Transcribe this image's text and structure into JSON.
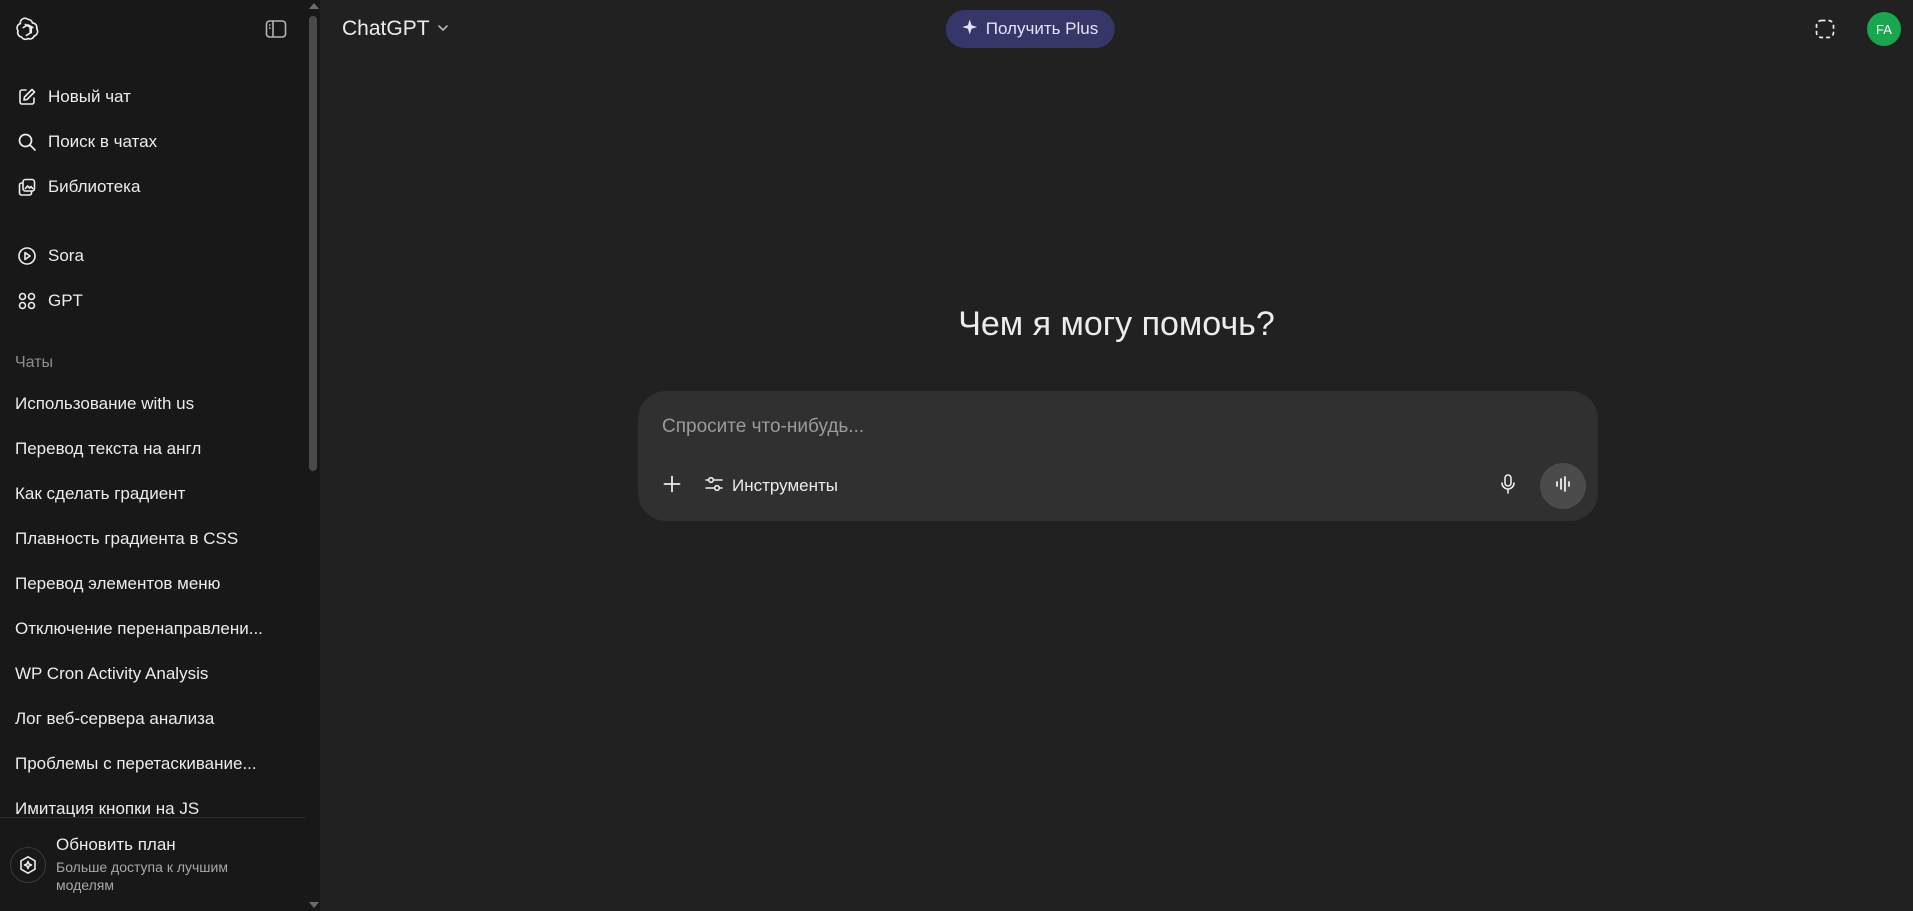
{
  "sidebar": {
    "nav": [
      {
        "label": "Новый чат",
        "icon": "new-chat-icon"
      },
      {
        "label": "Поиск в чатах",
        "icon": "search-icon"
      },
      {
        "label": "Библиотека",
        "icon": "library-icon"
      }
    ],
    "apps": [
      {
        "label": "Sora",
        "icon": "play-circle-icon"
      },
      {
        "label": "GPT",
        "icon": "grid-icon"
      }
    ],
    "section_title": "Чаты",
    "chats": [
      "Использование with us",
      "Перевод текста на англ",
      "Как сделать градиент",
      "Плавность градиента в CSS",
      "Перевод элементов меню",
      "Отключение перенаправлени...",
      "WP Cron Activity Analysis",
      "Лог веб-сервера анализа",
      "Проблемы с перетаскивание...",
      "Имитация кнопки на JS"
    ],
    "upgrade": {
      "title": "Обновить план",
      "subtitle": "Больше доступа к лучшим моделям"
    }
  },
  "header": {
    "model": "ChatGPT",
    "plus_label": "Получить Plus",
    "avatar_initials": "FA"
  },
  "main": {
    "greeting": "Чем я могу помочь?",
    "input_placeholder": "Спросите что-нибудь...",
    "tools_label": "Инструменты"
  },
  "colors": {
    "sidebar_bg": "#181818",
    "main_bg": "#212121",
    "composer_bg": "#303030",
    "plus_bg": "#373669",
    "avatar_bg": "#1aa64f"
  }
}
